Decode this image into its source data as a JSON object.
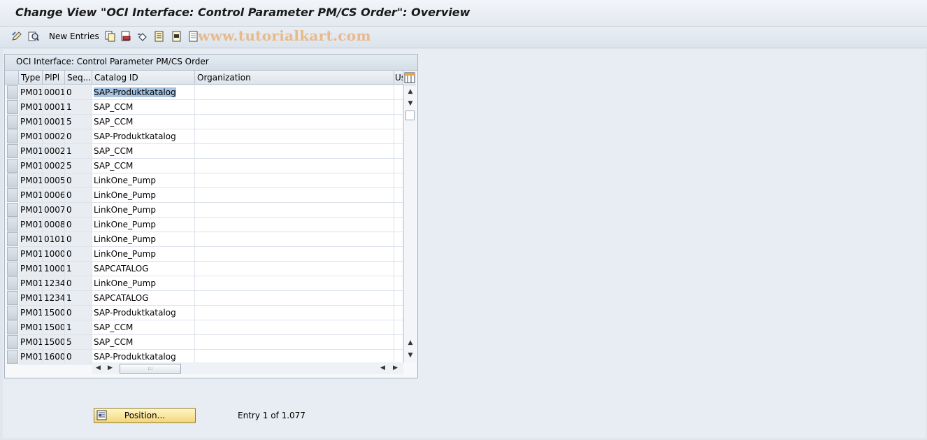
{
  "title": "Change View \"OCI Interface: Control Parameter PM/CS Order\": Overview",
  "toolbar": {
    "new_entries_label": "New Entries",
    "watermark": "www.tutorialkart.com",
    "icons": [
      "display-change-icon",
      "find-icon",
      "copy-as-icon",
      "delete-icon",
      "undo-icon",
      "select-all-icon",
      "select-block-icon",
      "deselect-all-icon"
    ]
  },
  "table": {
    "caption": "OCI Interface: Control Parameter PM/CS Order",
    "columns": {
      "type": "Type",
      "plpl": "PlPl",
      "seq": "Seq...",
      "catalog": "Catalog ID",
      "org": "Organization",
      "us": "Us"
    },
    "rows": [
      {
        "type": "PM01",
        "plpl": "0001",
        "seq": "0",
        "catalog": "SAP-Produktkatalog"
      },
      {
        "type": "PM01",
        "plpl": "0001",
        "seq": "1",
        "catalog": "SAP_CCM"
      },
      {
        "type": "PM01",
        "plpl": "0001",
        "seq": "5",
        "catalog": "SAP_CCM"
      },
      {
        "type": "PM01",
        "plpl": "0002",
        "seq": "0",
        "catalog": "SAP-Produktkatalog"
      },
      {
        "type": "PM01",
        "plpl": "0002",
        "seq": "1",
        "catalog": "SAP_CCM"
      },
      {
        "type": "PM01",
        "plpl": "0002",
        "seq": "5",
        "catalog": "SAP_CCM"
      },
      {
        "type": "PM01",
        "plpl": "0005",
        "seq": "0",
        "catalog": "LinkOne_Pump"
      },
      {
        "type": "PM01",
        "plpl": "0006",
        "seq": "0",
        "catalog": "LinkOne_Pump"
      },
      {
        "type": "PM01",
        "plpl": "0007",
        "seq": "0",
        "catalog": "LinkOne_Pump"
      },
      {
        "type": "PM01",
        "plpl": "0008",
        "seq": "0",
        "catalog": "LinkOne_Pump"
      },
      {
        "type": "PM01",
        "plpl": "0101",
        "seq": "0",
        "catalog": "LinkOne_Pump"
      },
      {
        "type": "PM01",
        "plpl": "1000",
        "seq": "0",
        "catalog": "LinkOne_Pump"
      },
      {
        "type": "PM01",
        "plpl": "1000",
        "seq": "1",
        "catalog": "SAPCATALOG"
      },
      {
        "type": "PM01",
        "plpl": "1234",
        "seq": "0",
        "catalog": "LinkOne_Pump"
      },
      {
        "type": "PM01",
        "plpl": "1234",
        "seq": "1",
        "catalog": "SAPCATALOG"
      },
      {
        "type": "PM01",
        "plpl": "1500",
        "seq": "0",
        "catalog": "SAP-Produktkatalog"
      },
      {
        "type": "PM01",
        "plpl": "1500",
        "seq": "1",
        "catalog": "SAP_CCM"
      },
      {
        "type": "PM01",
        "plpl": "1500",
        "seq": "5",
        "catalog": "SAP_CCM"
      },
      {
        "type": "PM01",
        "plpl": "1600",
        "seq": "0",
        "catalog": "SAP-Produktkatalog"
      }
    ]
  },
  "footer": {
    "position_label": "Position...",
    "entry_text": "Entry 1 of 1.077"
  }
}
